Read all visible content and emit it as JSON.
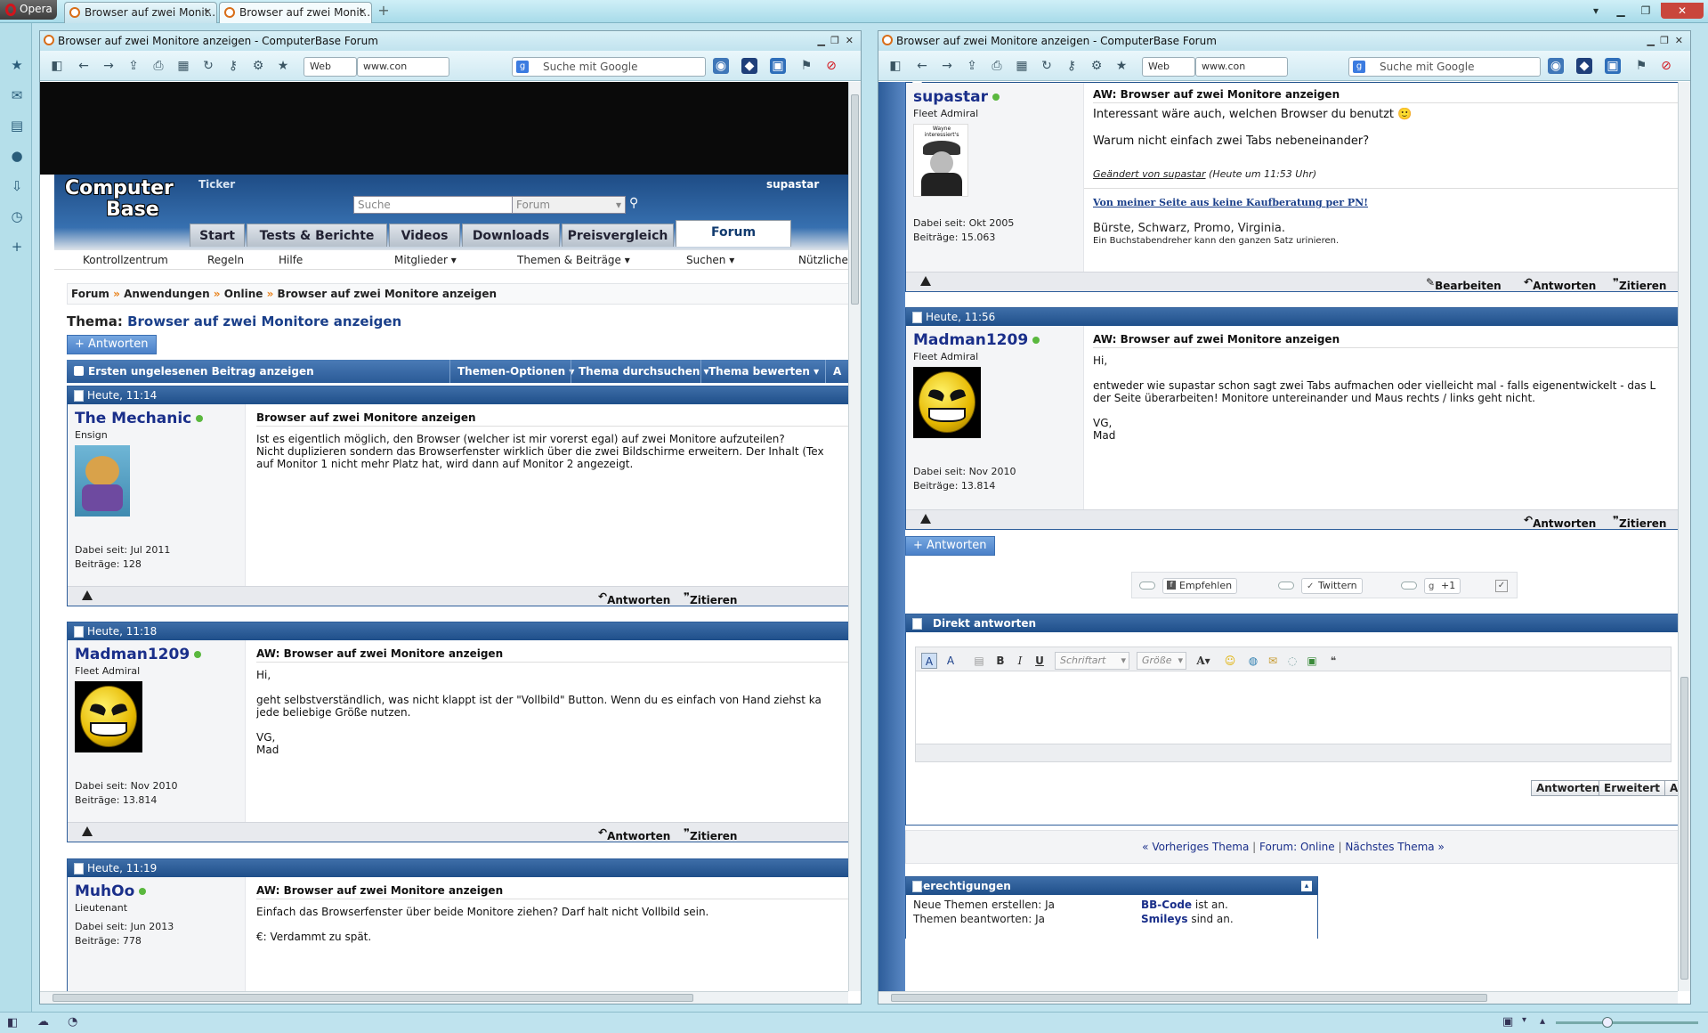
{
  "titlebar": {
    "opera_label": "Opera",
    "tabs": [
      {
        "title": "Browser auf zwei Monit..."
      },
      {
        "title": "Browser auf zwei Monit..."
      }
    ]
  },
  "left": {
    "window_title": "Browser auf zwei Monitore anzeigen - ComputerBase Forum",
    "address": "www.con",
    "search_engine_label": "Web",
    "search_placeholder": "Suche mit Google",
    "forum": {
      "logo_line1": "Computer",
      "logo_line2": "Base",
      "ticker": "Ticker",
      "username": "supastar",
      "search_placeholder": "Suche",
      "search_scope": "Forum",
      "nav_tabs": [
        "Start",
        "Tests & Berichte",
        "Videos",
        "Downloads",
        "Preisvergleich",
        "Forum"
      ],
      "subnav": [
        "Kontrollzentrum",
        "Regeln",
        "Hilfe",
        "Mitglieder ▾",
        "Themen & Beiträge ▾",
        "Suchen ▾",
        "Nützliche"
      ],
      "breadcrumb": [
        "Forum",
        "Anwendungen",
        "Online",
        "Browser auf zwei Monitore anzeigen"
      ],
      "breadcrumb_sep": "»",
      "thread_label": "Thema:",
      "thread_title": "Browser auf zwei Monitore anzeigen",
      "reply_button": "+ Antworten",
      "thread_tools": {
        "first_unread": "Ersten ungelesenen Beitrag anzeigen",
        "options": "Themen-Optionen ▾",
        "search": "Thema durchsuchen ▾",
        "rate": "Thema bewerten ▾",
        "more": "A"
      },
      "posts": [
        {
          "time": "Heute, 11:14",
          "user": "The Mechanic",
          "rank": "Ensign",
          "since": "Dabei seit: Jul 2011",
          "posts": "Beiträge: 128",
          "title": "Browser auf zwei Monitore anzeigen",
          "body": "Ist es eigentlich möglich, den Browser (welcher ist mir vorerst egal) auf zwei Monitore aufzuteilen?\nNicht duplizieren sondern das Browserfenster wirklich über die zwei Bildschirme erweitern. Der Inhalt (Tex\nauf Monitor 1 nicht mehr Platz hat, wird dann auf Monitor 2 angezeigt.",
          "reply": "Antworten",
          "quote": "Zitieren"
        },
        {
          "time": "Heute, 11:18",
          "user": "Madman1209",
          "rank": "Fleet Admiral",
          "since": "Dabei seit: Nov 2010",
          "posts": "Beiträge: 13.814",
          "title": "AW: Browser auf zwei Monitore anzeigen",
          "body": "Hi,\n\ngeht selbstverständlich, was nicht klappt ist der \"Vollbild\" Button. Wenn du es einfach von Hand ziehst ka\njede beliebige Größe nutzen.\n\nVG,\nMad",
          "reply": "Antworten",
          "quote": "Zitieren"
        },
        {
          "time": "Heute, 11:19",
          "user": "MuhOo",
          "rank": "Lieutenant",
          "since": "Dabei seit: Jun 2013",
          "posts": "Beiträge: 778",
          "title": "AW: Browser auf zwei Monitore anzeigen",
          "body": "Einfach das Browserfenster über beide Monitore ziehen? Darf halt nicht Vollbild sein.\n\n€: Verdammt zu spät."
        }
      ]
    }
  },
  "right": {
    "window_title": "Browser auf zwei Monitore anzeigen - ComputerBase Forum",
    "address": "www.con",
    "search_engine_label": "Web",
    "search_placeholder": "Suche mit Google",
    "forum": {
      "posts": [
        {
          "user": "supastar",
          "rank": "Fleet Admiral",
          "since": "Dabei seit: Okt 2005",
          "posts": "Beiträge: 15.063",
          "avatar_caption": "Wayne interessiert's",
          "title": "AW: Browser auf zwei Monitore anzeigen",
          "body": "Interessant wäre auch, welchen Browser du benutzt 🙂\n\nWarum nicht einfach zwei Tabs nebeneinander?",
          "edited_by": "Geändert von supastar",
          "edited_time": "(Heute um 11:53 Uhr)",
          "sig_link": "Von meiner Seite aus keine Kaufberatung per PN!",
          "sig_line1": "Bürste, Schwarz, Promo, Virginia.",
          "sig_line2": "Ein Buchstabendreher kann den ganzen Satz urinieren.",
          "edit": "Bearbeiten",
          "reply": "Antworten",
          "quote": "Zitieren"
        },
        {
          "time": "Heute, 11:56",
          "user": "Madman1209",
          "rank": "Fleet Admiral",
          "since": "Dabei seit: Nov 2010",
          "posts": "Beiträge: 13.814",
          "title": "AW: Browser auf zwei Monitore anzeigen",
          "body": "Hi,\n\nentweder wie supastar schon sagt zwei Tabs aufmachen oder vielleicht mal - falls eigenentwickelt - das L\nder Seite überarbeiten! Monitore untereinander und Maus rechts / links geht nicht.\n\nVG,\nMad",
          "reply": "Antworten",
          "quote": "Zitieren"
        }
      ],
      "reply_button": "+ Antworten",
      "share": {
        "facebook": "Empfehlen",
        "twitter": "Twittern",
        "gplus": "+1"
      },
      "quick_reply": {
        "title": "Direkt antworten",
        "font_select": "Schriftart",
        "size_select": "Größe",
        "submit": "Antworten",
        "advanced": "Erweitert",
        "more": "A"
      },
      "thread_nav": {
        "prev": "« Vorheriges Thema",
        "forum": "Forum: Online",
        "next": "Nächstes Thema »",
        "sep": "|"
      },
      "permissions": {
        "title": "Berechtigungen",
        "rows": [
          {
            "label": "Neue Themen erstellen: Ja",
            "code_label": "BB-Code",
            "code_state": "ist an."
          },
          {
            "label": "Themen beantworten: Ja",
            "code_label": "Smileys",
            "code_state": "sind an."
          }
        ]
      }
    }
  },
  "colors": {
    "forum_blue": "#1f4f8a",
    "link": "#1a2f8a",
    "accent_orange": "#e8811a"
  }
}
